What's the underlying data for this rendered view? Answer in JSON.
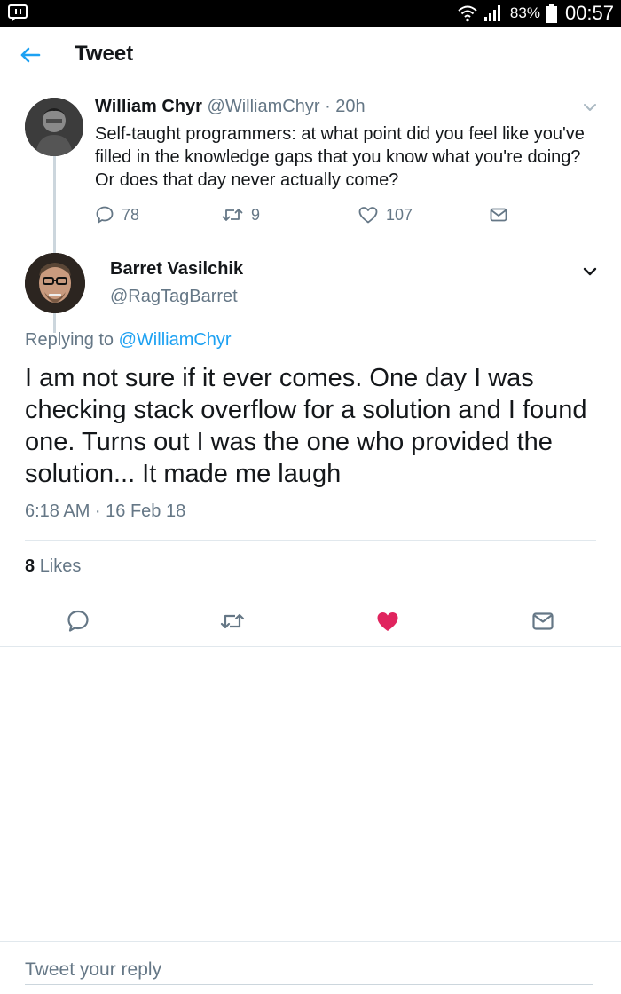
{
  "status_bar": {
    "battery": "83%",
    "time": "00:57"
  },
  "header": {
    "title": "Tweet"
  },
  "parent_tweet": {
    "author_name": "William Chyr",
    "author_handle": "@WilliamChyr",
    "separator": "·",
    "age": "20h",
    "text": "Self-taught programmers: at what point did you feel like you've filled in the knowledge gaps that you know what you're doing? Or does that day never actually come?",
    "replies": "78",
    "retweets": "9",
    "likes": "107"
  },
  "main_tweet": {
    "author_name": "Barret Vasilchik",
    "author_handle": "@RagTagBarret",
    "replying_prefix": "Replying to",
    "replying_to": "@WilliamChyr",
    "text": "I am not sure if it ever comes. One day I was checking stack overflow for a solution and I found one. Turns out I was the one who provided the solution... It made me laugh",
    "timestamp": "6:18 AM · 16 Feb 18",
    "likes_count": "8",
    "likes_label": "Likes",
    "liked": true
  },
  "reply_bar": {
    "placeholder": "Tweet your reply"
  },
  "colors": {
    "accent": "#1da1f2",
    "like": "#e0245e",
    "secondary_text": "#657786",
    "divider": "#e1e8ed"
  },
  "icons": {
    "status_left": "app-notification-icon",
    "status_right": [
      "wifi-icon",
      "signal-icon",
      "battery-icon"
    ],
    "header": "back-arrow-icon",
    "parent_actions": [
      "reply-icon",
      "retweet-icon",
      "like-outline-icon",
      "direct-message-icon"
    ],
    "main_actions": [
      "reply-icon",
      "retweet-icon",
      "like-filled-icon",
      "direct-message-icon"
    ],
    "menu": "chevron-down-icon"
  }
}
